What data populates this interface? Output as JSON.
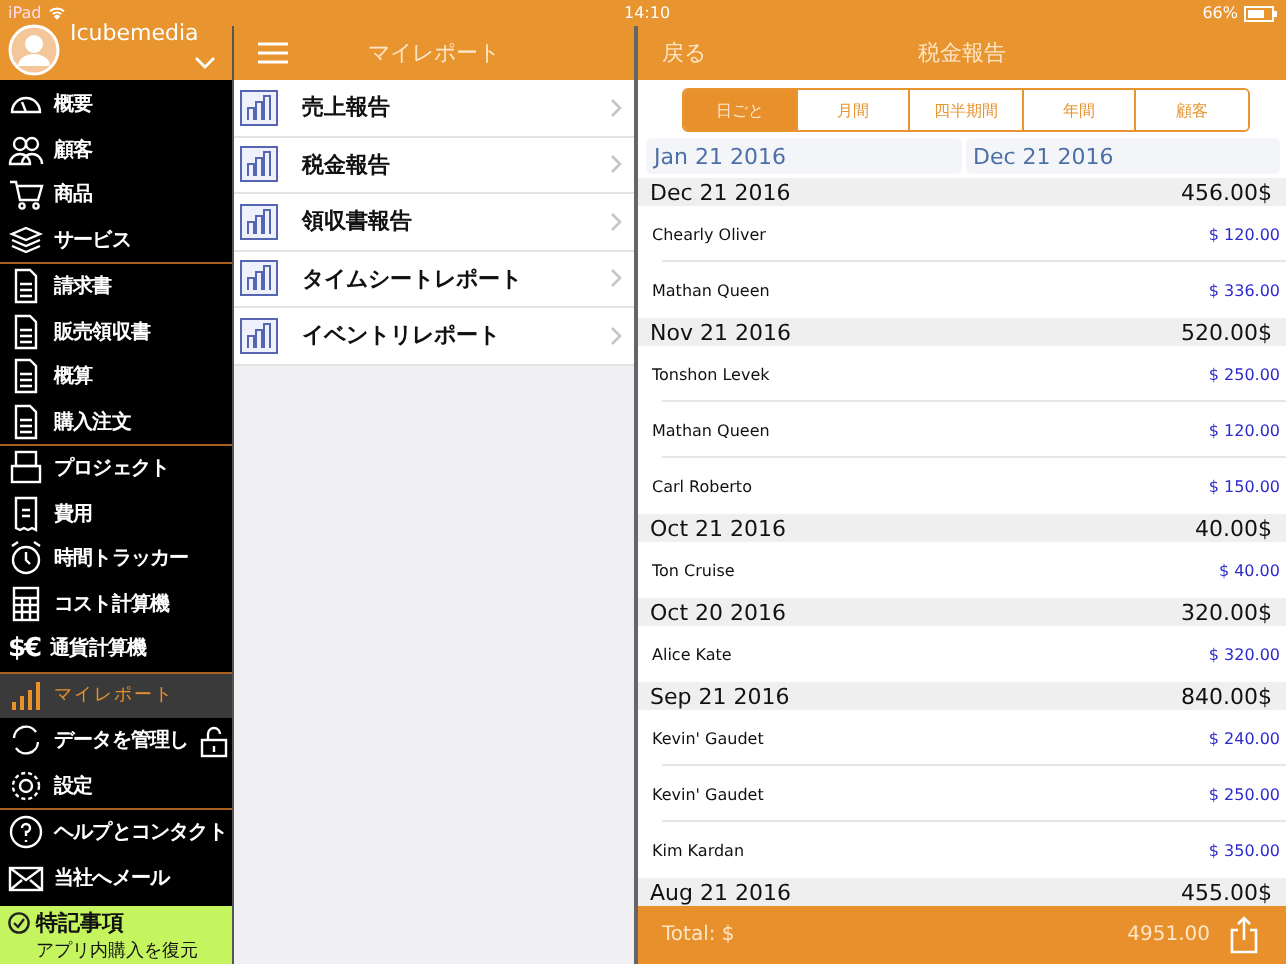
{
  "status_bar": {
    "device": "iPad",
    "time": "14:10",
    "battery": "66%"
  },
  "account": {
    "name": "Icubemedia"
  },
  "sidebar": {
    "sections": [
      {
        "items": [
          {
            "label": "概要",
            "selected": false,
            "locked": false
          },
          {
            "label": "顧客",
            "selected": false,
            "locked": false
          },
          {
            "label": "商品",
            "selected": false,
            "locked": false
          },
          {
            "label": "サービス",
            "selected": false,
            "locked": false
          }
        ]
      },
      {
        "items": [
          {
            "label": "請求書",
            "selected": false,
            "locked": false
          },
          {
            "label": "販売領収書",
            "selected": false,
            "locked": false
          },
          {
            "label": "概算",
            "selected": false,
            "locked": false
          },
          {
            "label": "購入注文",
            "selected": false,
            "locked": false
          }
        ]
      },
      {
        "items": [
          {
            "label": "プロジェクト",
            "selected": false,
            "locked": false
          },
          {
            "label": "費用",
            "selected": false,
            "locked": false
          },
          {
            "label": "時間トラッカー",
            "selected": false,
            "locked": false
          },
          {
            "label": "コスト計算機",
            "selected": false,
            "locked": false
          },
          {
            "label": "通貨計算機",
            "symbol": "$€",
            "selected": false,
            "locked": false
          }
        ]
      },
      {
        "items": [
          {
            "label": "マイレポート",
            "selected": true,
            "locked": false
          },
          {
            "label": "データを管理し",
            "selected": false,
            "locked": true
          },
          {
            "label": "設定",
            "selected": false,
            "locked": false
          }
        ]
      },
      {
        "items": [
          {
            "label": "ヘルプとコンタクト",
            "selected": false,
            "locked": false
          },
          {
            "label": "当社へメール",
            "selected": false,
            "locked": false
          }
        ]
      }
    ]
  },
  "promo": {
    "title": "特記事項",
    "subtitle": "アプリ内購入を復元"
  },
  "reports": {
    "title": "マイレポート",
    "items": [
      {
        "label": "売上報告"
      },
      {
        "label": "税金報告"
      },
      {
        "label": "領収書報告"
      },
      {
        "label": "タイムシートレポート"
      },
      {
        "label": "イベントリレポート"
      }
    ]
  },
  "detail": {
    "back": "戻る",
    "title": "税金報告",
    "segments": [
      {
        "label": "日ごと",
        "selected": true
      },
      {
        "label": "月間",
        "selected": false
      },
      {
        "label": "四半期間",
        "selected": false
      },
      {
        "label": "年間",
        "selected": false
      },
      {
        "label": "顧客",
        "selected": false
      }
    ],
    "date_from": "Jan 21 2016",
    "date_to": "Dec 21 2016",
    "groups": [
      {
        "date": "Dec 21 2016",
        "total": "456.00$",
        "entries": [
          {
            "name": "Chearly Oliver",
            "amount": "$ 120.00"
          },
          {
            "name": "Mathan  Queen",
            "amount": "$ 336.00"
          }
        ]
      },
      {
        "date": "Nov 21 2016",
        "total": "520.00$",
        "entries": [
          {
            "name": "Tonshon  Levek",
            "amount": "$ 250.00"
          },
          {
            "name": "Mathan  Queen",
            "amount": "$ 120.00"
          },
          {
            "name": "Carl Roberto",
            "amount": "$ 150.00"
          }
        ]
      },
      {
        "date": "Oct 21 2016",
        "total": "40.00$",
        "entries": [
          {
            "name": "Ton  Cruise",
            "amount": "$ 40.00"
          }
        ]
      },
      {
        "date": "Oct 20 2016",
        "total": "320.00$",
        "entries": [
          {
            "name": "Alice Kate",
            "amount": "$ 320.00"
          }
        ]
      },
      {
        "date": "Sep 21 2016",
        "total": "840.00$",
        "entries": [
          {
            "name": "Kevin'  Gaudet",
            "amount": "$ 240.00"
          },
          {
            "name": "Kevin'  Gaudet",
            "amount": "$ 250.00"
          },
          {
            "name": "Kim Kardan",
            "amount": "$ 350.00"
          }
        ]
      },
      {
        "date": "Aug 21 2016",
        "total": "455.00$"
      }
    ],
    "footer": {
      "label": "Total: $",
      "total": "4951.00"
    }
  }
}
